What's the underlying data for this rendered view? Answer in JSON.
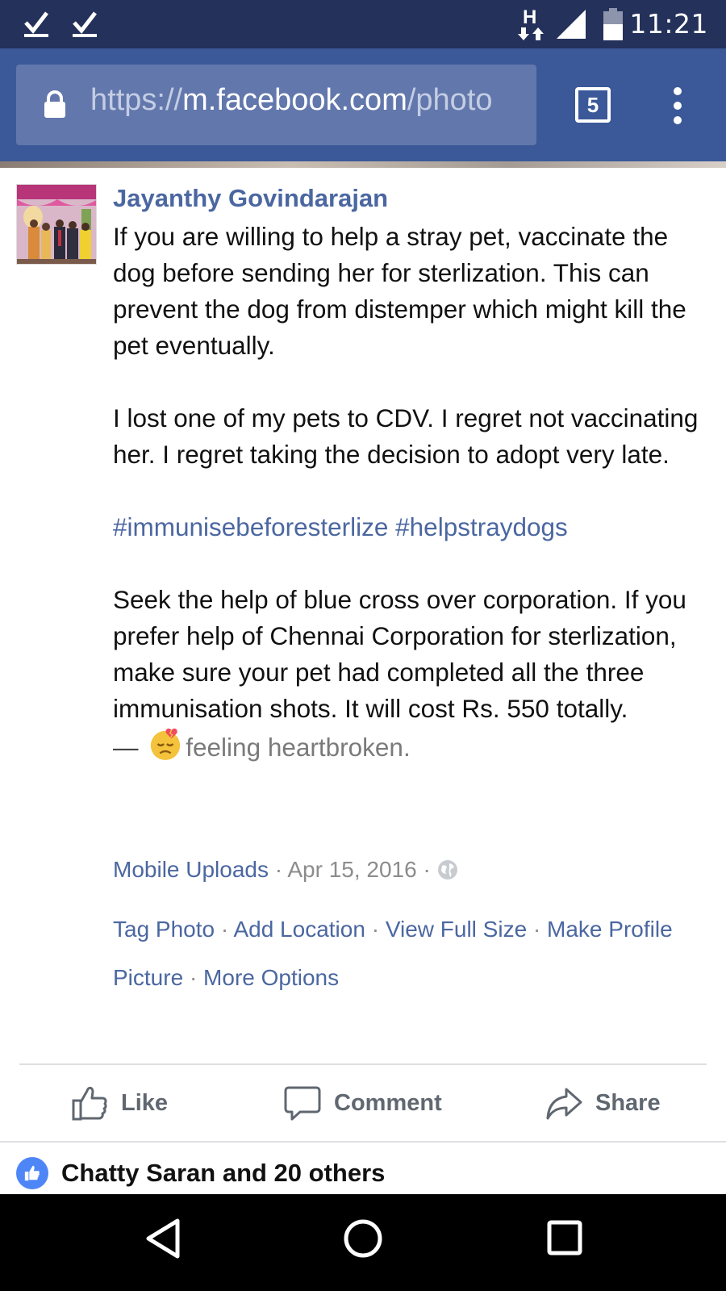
{
  "status_bar": {
    "time": "11:21",
    "network": "H",
    "icons": [
      "check-icon",
      "check-icon",
      "network-h-icon",
      "signal-icon",
      "battery-icon"
    ]
  },
  "browser": {
    "url_scheme": "https://",
    "url_host": "m.facebook.com",
    "url_path": "/photo",
    "tab_count": "5",
    "colors": {
      "bar": "#3b5998",
      "status": "#24315a",
      "urlbox": "#6277ac"
    }
  },
  "post": {
    "author": "Jayanthy Govindarajan",
    "paragraphs": [
      "If you are willing to help a stray pet, vaccinate the dog before sending her for sterlization. This can prevent the dog from distemper which might kill the pet eventually.",
      "I lost one of my pets to CDV. I regret not vaccinating her. I regret taking the decision to adopt very late.",
      "#immunisebeforesterlize #helpstraydogs",
      "Seek the help of blue cross over corporation. If you prefer help of Chennai Corporation for sterlization, make sure your pet had completed all the three immunisation shots. It will cost Rs. 550 totally."
    ],
    "feeling_prefix": "—",
    "feeling_text": "feeling heartbroken.",
    "album": "Mobile Uploads",
    "date": "Apr 15, 2016",
    "sep": "·",
    "photo_links": [
      "Tag Photo",
      "Add Location",
      "View Full Size",
      "Make Profile Picture",
      "More Options"
    ]
  },
  "actions": {
    "like": "Like",
    "comment": "Comment",
    "share": "Share"
  },
  "reactions": {
    "summary": "Chatty Saran and 20 others"
  },
  "nav": {
    "icons": [
      "back-icon",
      "home-icon",
      "recents-icon"
    ]
  },
  "colors": {
    "link": "#4b67a1",
    "muted": "#8c8c8c",
    "action": "#606770",
    "like_badge": "#4e86f7"
  }
}
